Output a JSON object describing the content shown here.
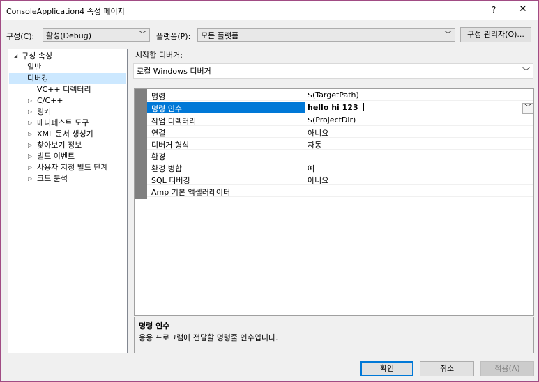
{
  "window": {
    "title": "ConsoleApplication4 속성 페이지",
    "help": "?",
    "close": "✕"
  },
  "config": {
    "config_label": "구성(C):",
    "config_value": "활성(Debug)",
    "platform_label": "플랫폼(P):",
    "platform_value": "모든 플랫폼",
    "manager_button": "구성 관리자(O)..."
  },
  "tree": {
    "root": "구성 속성",
    "items": [
      {
        "label": "일반",
        "expandable": false
      },
      {
        "label": "디버깅",
        "expandable": false,
        "selected": true
      },
      {
        "label": "VC++ 디렉터리",
        "expandable": false
      },
      {
        "label": "C/C++",
        "expandable": true
      },
      {
        "label": "링커",
        "expandable": true
      },
      {
        "label": "매니페스트 도구",
        "expandable": true
      },
      {
        "label": "XML 문서 생성기",
        "expandable": true
      },
      {
        "label": "찾아보기 정보",
        "expandable": true
      },
      {
        "label": "빌드 이벤트",
        "expandable": true
      },
      {
        "label": "사용자 지정 빌드 단계",
        "expandable": true
      },
      {
        "label": "코드 분석",
        "expandable": true
      }
    ]
  },
  "debugger": {
    "label": "시작할 디버거:",
    "value": "로컬 Windows 디버거"
  },
  "properties": [
    {
      "name": "명령",
      "value": "$(TargetPath)"
    },
    {
      "name": "명령 인수",
      "value": "hello hi 123",
      "selected": true
    },
    {
      "name": "작업 디렉터리",
      "value": "$(ProjectDir)"
    },
    {
      "name": "연결",
      "value": "아니요"
    },
    {
      "name": "디버거 형식",
      "value": "자동"
    },
    {
      "name": "환경",
      "value": ""
    },
    {
      "name": "환경 병합",
      "value": "예"
    },
    {
      "name": "SQL 디버깅",
      "value": "아니요"
    },
    {
      "name": "Amp 기본 액셀러레이터",
      "value": ""
    }
  ],
  "description": {
    "title": "명령 인수",
    "text": "응용 프로그램에 전달할 명령줄 인수입니다."
  },
  "buttons": {
    "ok": "확인",
    "cancel": "취소",
    "apply": "적용(A)"
  }
}
